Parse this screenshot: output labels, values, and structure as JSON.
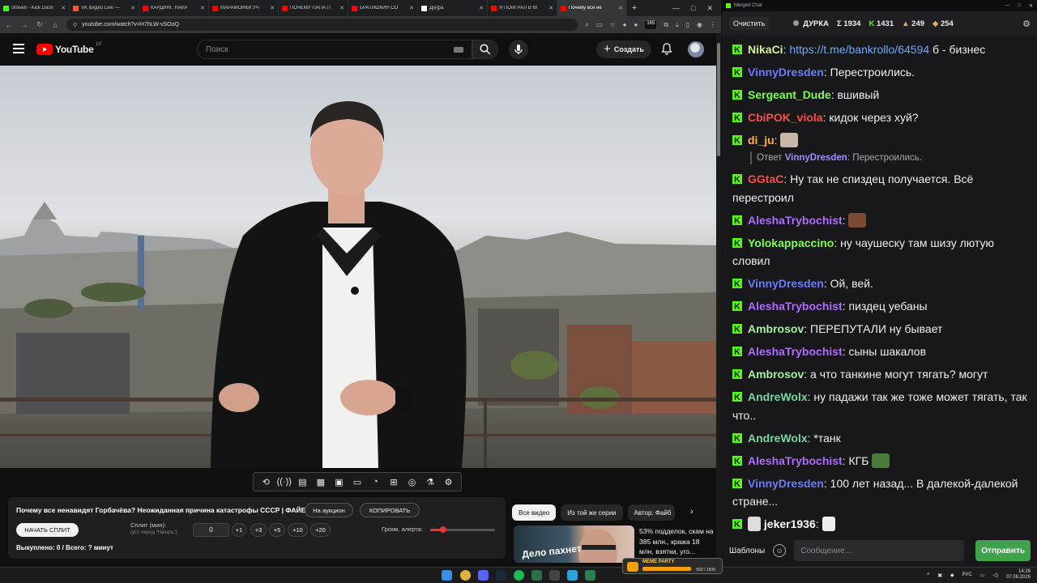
{
  "browser": {
    "tabs": [
      {
        "title": "Stream - Kick Dash",
        "color": "#53fc18"
      },
      {
        "title": "VK Видео Live —",
        "color": "#ff5a2b"
      },
      {
        "title": "КАРДИНГ, НАКР",
        "color": "#ff0000"
      },
      {
        "title": "МАРАМОЙКИ УЧ",
        "color": "#ff0000"
      },
      {
        "title": "ПОЧЕМУ ПАПА П",
        "color": "#ff0000"
      },
      {
        "title": "БРАТИШКИН СО",
        "color": "#ff0000"
      },
      {
        "title": "Д[e]ра",
        "color": "#ffffff"
      },
      {
        "title": "Я ПОИГРАЛ В W",
        "color": "#ff0000"
      },
      {
        "title": "Почему все не",
        "color": "#ff0000"
      }
    ],
    "url": "youtube.com/watch?v=H7hLW-vSOoQ",
    "ext_badge": "165"
  },
  "youtube": {
    "logo_text": "YouTube",
    "country": "LV",
    "search_placeholder": "Поиск",
    "create_label": "Создать"
  },
  "panel": {
    "title": "Почему все ненавидят Горбачёва? Неожиданная причина катастрофы СССР | ФАЙБ",
    "auction_label": "На аукцион",
    "copy_label": "КОПИРОВАТЬ",
    "split_button": "НАЧАТЬ СПЛИТ",
    "split_label": "Сплит (мин):",
    "split_hint": "(уст. перед \"Начать\")",
    "split_value": "0",
    "increments": [
      "+1",
      "+3",
      "+5",
      "+10",
      "+20"
    ],
    "alert_label": "Громк. алерта:",
    "alert_volume_fraction": 0.2,
    "bought_text": "Выкуплено: 0 / Всего: ? минут"
  },
  "related": {
    "chips": [
      "Все видео",
      "Из той же серии",
      "Автор: Файб"
    ],
    "thumb_text": "Дело пахнет",
    "title": "53% подделок, скам на 385 млн., кража 18 млн, взятки, уго..."
  },
  "chat": {
    "window_title": "Merged Chat",
    "clear_label": "Очистить",
    "channel": "ДУРКА",
    "stat_total": "Σ 1934",
    "stat_kick": "1431",
    "stat_other": "249",
    "stat_views": "254",
    "messages": [
      {
        "user": "NikaCi",
        "color": "#d0f0a0",
        "text": "https://t.me/bankrollo/64594",
        "link": true,
        "tail": " б - бизнес"
      },
      {
        "user": "VinnyDresden",
        "color": "#6b7cff",
        "text": "Перестроились."
      },
      {
        "user": "Sergeant_Dude",
        "color": "#7cff4f",
        "text": "вшивый"
      },
      {
        "user": "CbiPOK_viola",
        "color": "#ff4b4b",
        "text": "кидок через хуй?"
      },
      {
        "user": "di_ju",
        "color": "#ffb347",
        "text": "",
        "emote": "#c8b8a8"
      },
      {
        "reply_user": "VinnyDresden",
        "reply_text": "Перестроились.",
        "reply_prefix": "Ответ"
      },
      {
        "user": "GGtaC",
        "color": "#ff4b4b",
        "text": "Ну так не спиздец получается. Всё перестроил"
      },
      {
        "user": "AleshaTrybochist",
        "color": "#b06bff",
        "text": "",
        "emote": "#7a4a32"
      },
      {
        "user": "Yolokappaccino",
        "color": "#7cff4f",
        "text": "ну чаушеску там шизу лютую словил"
      },
      {
        "user": "VinnyDresden",
        "color": "#6b7cff",
        "text": "Ой, вей."
      },
      {
        "user": "AleshaTrybochist",
        "color": "#b06bff",
        "text": "пиздец уебаны"
      },
      {
        "user": "Ambrosov",
        "color": "#a3f0a0",
        "text": "ПЕРЕПУТАЛИ  ну бывает"
      },
      {
        "user": "AleshaTrybochist",
        "color": "#b06bff",
        "text": "сыны шакалов"
      },
      {
        "user": "Ambrosov",
        "color": "#a3f0a0",
        "text": "а что танкине могут тягать? могут"
      },
      {
        "user": "AndreWolx",
        "color": "#7ad6a0",
        "text": "ну падажи так же тоже может тягать, так что.."
      },
      {
        "user": "AndreWolx",
        "color": "#7ad6a0",
        "text": "*танк"
      },
      {
        "user": "AleshaTrybochist",
        "color": "#b06bff",
        "text": "КГБ",
        "emote": "#4a7a3a"
      },
      {
        "user": "VinnyDresden",
        "color": "#6b7cff",
        "text": "100 лет назад... В далекой-далекой стране..."
      },
      {
        "user": "jeker1936",
        "color": "#ffffff",
        "text": "",
        "emote": "#dddddd",
        "prefix_emote": true
      }
    ],
    "templates_label": "Шаблоны",
    "input_placeholder": "Сообщение...",
    "send_label": "Отправить"
  },
  "taskbar": {
    "lang": "РУС",
    "time": "14:26",
    "date": "07.08.2026",
    "popup_label": "MEME PARTY",
    "popup_count": "550 / 1500"
  }
}
